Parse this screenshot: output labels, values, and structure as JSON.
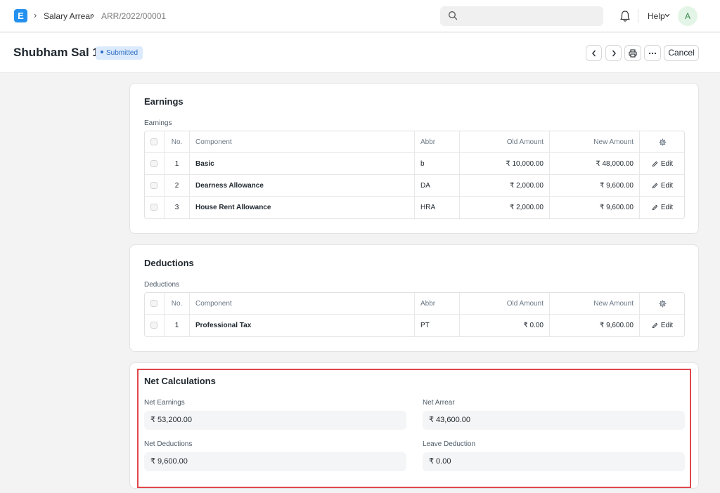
{
  "navbar": {
    "logo": "E",
    "breadcrumbs": [
      "Salary Arrear",
      "ARR/2022/00001"
    ],
    "search_placeholder": "",
    "help_label": "Help",
    "avatar_initial": "A"
  },
  "page": {
    "title": "Shubham Sal 1",
    "status": "Submitted",
    "cancel_label": "Cancel"
  },
  "earnings": {
    "section_title": "Earnings",
    "table_label": "Earnings",
    "columns": [
      "No.",
      "Component",
      "Abbr",
      "Old Amount",
      "New Amount"
    ],
    "rows": [
      {
        "no": "1",
        "component": "Basic",
        "abbr": "b",
        "old": "₹ 10,000.00",
        "new": "₹ 48,000.00"
      },
      {
        "no": "2",
        "component": "Dearness Allowance",
        "abbr": "DA",
        "old": "₹ 2,000.00",
        "new": "₹ 9,600.00"
      },
      {
        "no": "3",
        "component": "House Rent Allowance",
        "abbr": "HRA",
        "old": "₹ 2,000.00",
        "new": "₹ 9,600.00"
      }
    ]
  },
  "deductions": {
    "section_title": "Deductions",
    "table_label": "Deductions",
    "columns": [
      "No.",
      "Component",
      "Abbr",
      "Old Amount",
      "New Amount"
    ],
    "rows": [
      {
        "no": "1",
        "component": "Professional Tax",
        "abbr": "PT",
        "old": "₹ 0.00",
        "new": "₹ 9,600.00"
      }
    ]
  },
  "edit_label": "Edit",
  "net": {
    "section_title": "Net Calculations",
    "net_earnings_label": "Net Earnings",
    "net_earnings_value": "₹ 53,200.00",
    "net_arrear_label": "Net Arrear",
    "net_arrear_value": "₹ 43,600.00",
    "net_deductions_label": "Net Deductions",
    "net_deductions_value": "₹ 9,600.00",
    "leave_deduction_label": "Leave Deduction",
    "leave_deduction_value": "₹ 0.00"
  },
  "colors": {
    "brand": "#2490ef",
    "status_bg": "#dbeafd",
    "status_text": "#2a6cc3",
    "highlight": "#e0474c"
  }
}
